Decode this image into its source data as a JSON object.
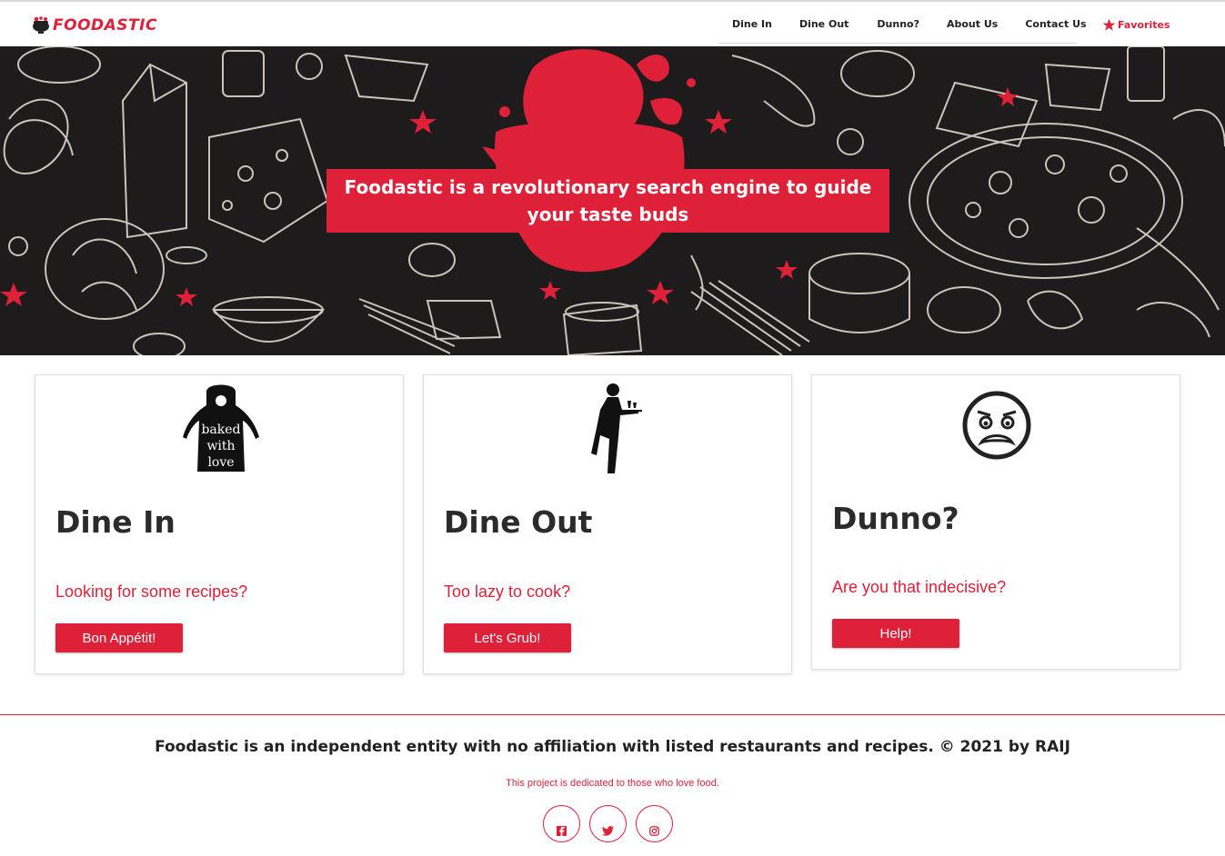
{
  "brand": {
    "name": "FOODASTIC",
    "accent": "#de2039"
  },
  "nav": {
    "items": [
      "Dine In",
      "Dine Out",
      "Dunno?",
      "About Us",
      "Contact Us"
    ],
    "favorites_label": "Favorites",
    "favorites_icon": "star-icon"
  },
  "hero": {
    "tagline": "Foodastic is a revolutionary search engine to guide your taste buds"
  },
  "cards": [
    {
      "title": "Dine In",
      "subtitle": "Looking for some recipes?",
      "button": "Bon Appétit!",
      "icon": "apron-icon",
      "icon_text": [
        "baked",
        "with",
        "love"
      ]
    },
    {
      "title": "Dine Out",
      "subtitle": "Too lazy to cook?",
      "button": "Let's Grub!",
      "icon": "waiter-icon"
    },
    {
      "title": "Dunno?",
      "subtitle": "Are you that indecisive?",
      "button": "Help!",
      "icon": "confused-face-icon"
    }
  ],
  "footer": {
    "disclaimer": "Foodastic is an independent entity with no affiliation with listed restaurants and recipes. © 2021 by RAIJ",
    "dedication": "This project is dedicated to those who love food.",
    "social": [
      "facebook-icon",
      "twitter-icon",
      "instagram-icon"
    ]
  }
}
